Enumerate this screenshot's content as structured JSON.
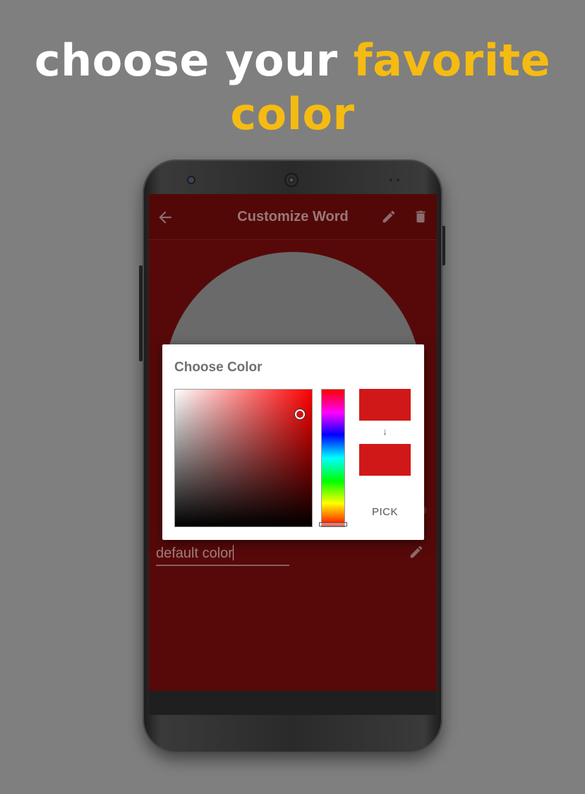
{
  "headline": {
    "line1_white": "choose your",
    "line1_yellow": "favorite",
    "line2_yellow": "color"
  },
  "appbar": {
    "title": "Customize Word",
    "back_icon": "arrow-left-icon",
    "edit_icon": "pencil-icon",
    "delete_icon": "trash-icon"
  },
  "word_field": {
    "value": "default color",
    "edit_icon": "pencil-icon"
  },
  "dialog": {
    "title": "Choose Color",
    "old_color": "#d11818",
    "new_color": "#d11818",
    "arrow": "↓",
    "pick_label": "PICK"
  },
  "colors": {
    "background": "#7f7f7f",
    "headline_accent": "#f5bb12",
    "screen_bg": "#570909"
  }
}
